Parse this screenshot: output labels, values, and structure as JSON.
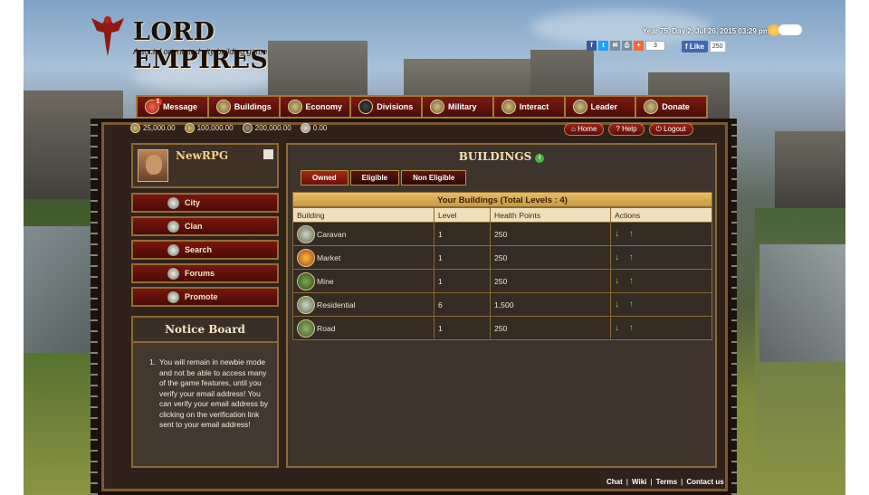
{
  "brand": {
    "title": "LORD EMPIRES",
    "tagline": "A social orientated city building game"
  },
  "datetime": "Year 75, Day 2, Jul 26, 2015 03:29 pm",
  "share": {
    "addthis_count": "3",
    "fb_like_label": "Like",
    "fb_like_count": "250"
  },
  "nav": [
    {
      "label": "Message",
      "badge": "1",
      "icon": "message-icon"
    },
    {
      "label": "Buildings",
      "icon": "buildings-icon"
    },
    {
      "label": "Economy",
      "icon": "economy-icon"
    },
    {
      "label": "Divisions",
      "icon": "divisions-icon"
    },
    {
      "label": "Military",
      "icon": "military-icon"
    },
    {
      "label": "Interact",
      "icon": "interact-icon"
    },
    {
      "label": "Leader",
      "icon": "leader-icon"
    },
    {
      "label": "Donate",
      "icon": "donate-icon"
    }
  ],
  "resources": [
    {
      "value": "25,000.00",
      "icon": "gold-icon"
    },
    {
      "value": "100,000.00",
      "icon": "wood-icon"
    },
    {
      "value": "200,000.00",
      "icon": "stone-icon"
    },
    {
      "value": "0.00",
      "icon": "gem-icon"
    }
  ],
  "links": {
    "home": "Home",
    "help": "Help",
    "logout": "Logout"
  },
  "profile": {
    "name": "NewRPG"
  },
  "side_menu": [
    {
      "label": "City",
      "icon": "city-icon"
    },
    {
      "label": "Clan",
      "icon": "clan-icon"
    },
    {
      "label": "Search",
      "icon": "search-icon"
    },
    {
      "label": "Forums",
      "icon": "forums-icon"
    },
    {
      "label": "Promote",
      "icon": "promote-icon"
    }
  ],
  "notice": {
    "title": "Notice Board",
    "items": [
      {
        "num": "1.",
        "text": "You will remain in newbie mode and not be able to access many of the game features, until you verify your email address! You can verify your email address by clicking on the verification link sent to your email address!"
      }
    ]
  },
  "buildings": {
    "title": "BUILDINGS",
    "tabs": [
      "Owned",
      "Eligible",
      "Non Eligible"
    ],
    "caption": "Your Buildings (Total Levels : 4)",
    "columns": [
      "Building",
      "Level",
      "Health Points",
      "Actions"
    ],
    "rows": [
      {
        "name": "Caravan",
        "level": "1",
        "hp": "250"
      },
      {
        "name": "Market",
        "level": "1",
        "hp": "250"
      },
      {
        "name": "Mine",
        "level": "1",
        "hp": "250"
      },
      {
        "name": "Residential",
        "level": "6",
        "hp": "1,500"
      },
      {
        "name": "Road",
        "level": "1",
        "hp": "250"
      }
    ],
    "actions": "↓ ↑"
  },
  "footer": [
    "Chat",
    "Wiki",
    "Terms",
    "Contact us"
  ],
  "colors": {
    "accent_red": "#7c1a12",
    "gold": "#e5bd66",
    "border_gold": "#8b6a35"
  }
}
